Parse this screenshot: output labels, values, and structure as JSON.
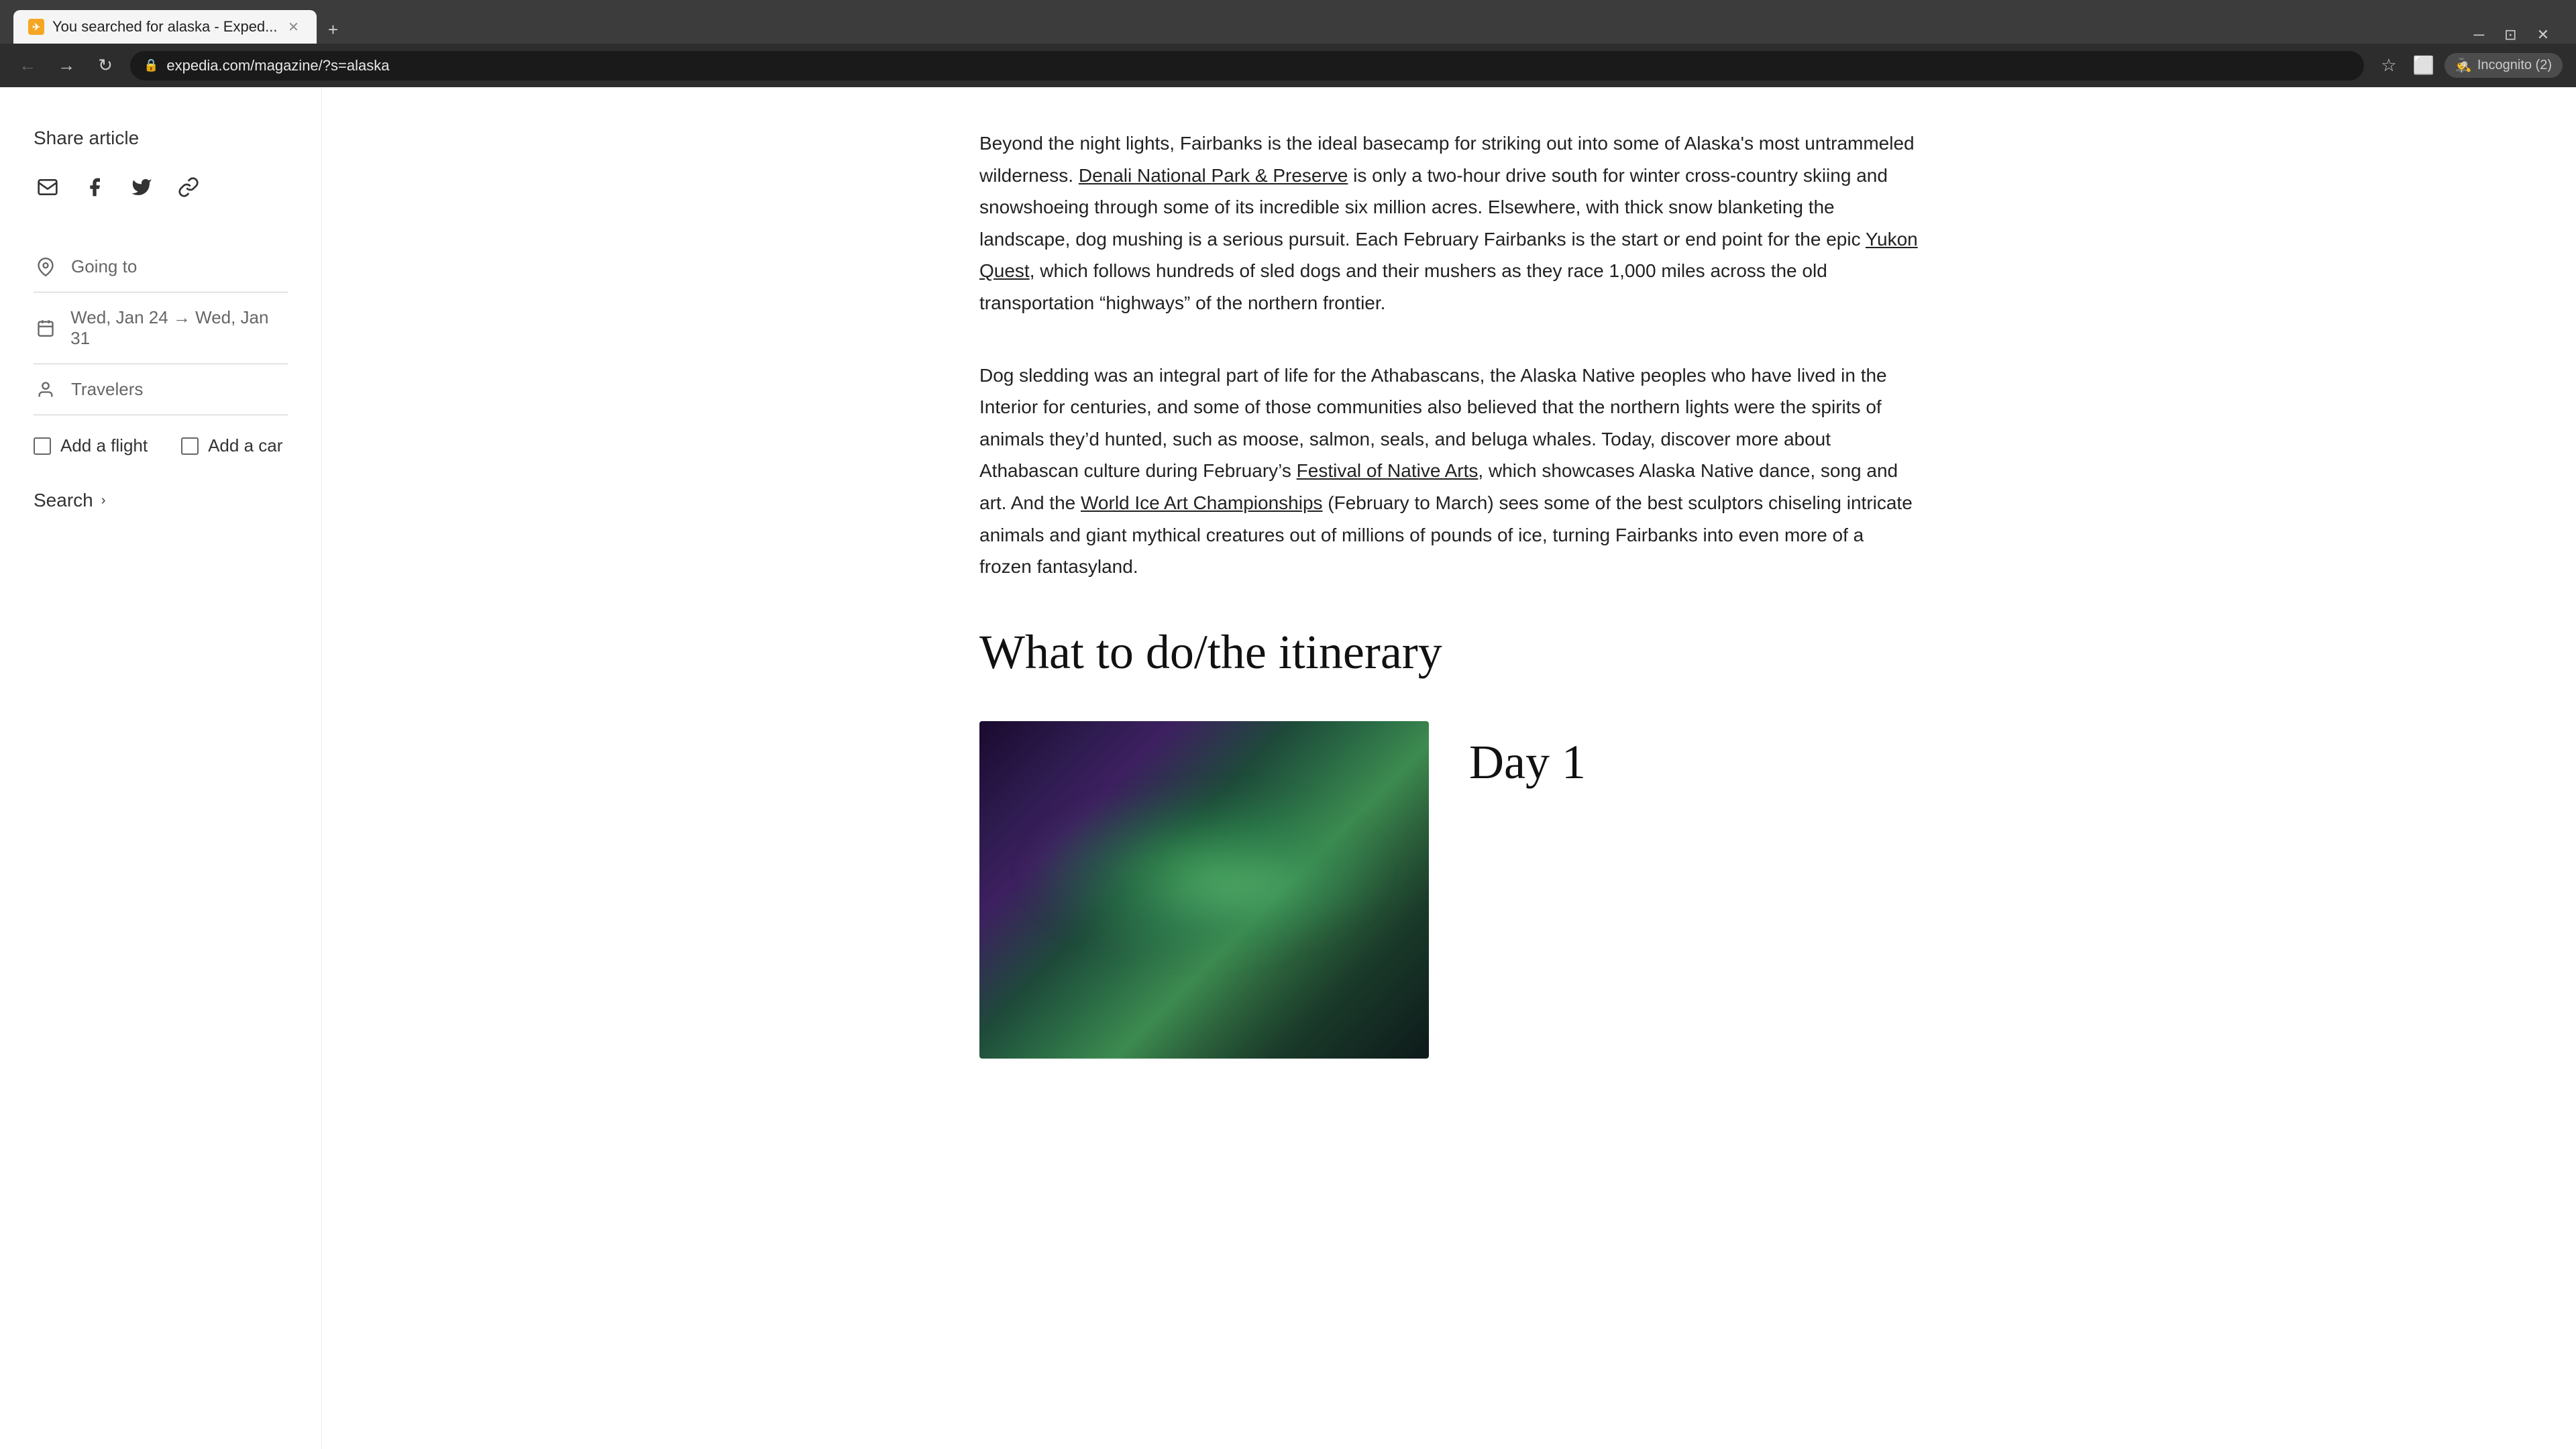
{
  "browser": {
    "tab_title": "You searched for alaska - Exped...",
    "tab_favicon": "✈",
    "url": "expedia.com/magazine/?s=alaska",
    "incognito_label": "Incognito (2)"
  },
  "sidebar": {
    "share_label": "Share article",
    "social_icons": [
      "email",
      "facebook",
      "twitter",
      "link"
    ],
    "going_to_placeholder": "Going to",
    "dates_value": "Wed, Jan 24 → Wed, Jan 31",
    "travelers_placeholder": "Travelers",
    "add_flight_label": "Add a flight",
    "add_car_label": "Add a car",
    "search_label": "Search"
  },
  "article": {
    "paragraph1": "Beyond the night lights, Fairbanks is the ideal basecamp for striking out into some of Alaska's most untrammeled wilderness.",
    "denali_link": "Denali National Park & Preserve",
    "paragraph1_cont": " is only a two-hour drive south for winter cross-country skiing and snowshoeing through some of its incredible six million acres. Elsewhere, with thick snow blanketing the landscape, dog mushing is a serious pursuit. Each February Fairbanks is the start or end point for the epic ",
    "yukon_quest_link": "Yukon Quest",
    "paragraph1_end": ", which follows hundreds of sled dogs and their mushers as they race 1,000 miles across the old transportation “highways” of the northern frontier.",
    "paragraph2": "Dog sledding was an integral part of life for the Athabascans, the Alaska Native peoples who have lived in the Interior for centuries, and some of those communities also believed that the northern lights were the spirits of animals they’d hunted, such as moose, salmon, seals, and beluga whales. Today, discover more about Athabascan culture during February’s ",
    "festival_link": "Festival of Native Arts",
    "paragraph2_mid": ", which showcases Alaska Native dance, song and art. And the ",
    "world_ice_link": "World Ice Art Championships",
    "paragraph2_end": " (February to March) sees some of the best sculptors chiseling intricate animals and giant mythical creatures out of millions of pounds of ice, turning Fairbanks into even more of a frozen fantasyland.",
    "section_heading": "What to do/the itinerary",
    "day1_label": "Day 1"
  }
}
